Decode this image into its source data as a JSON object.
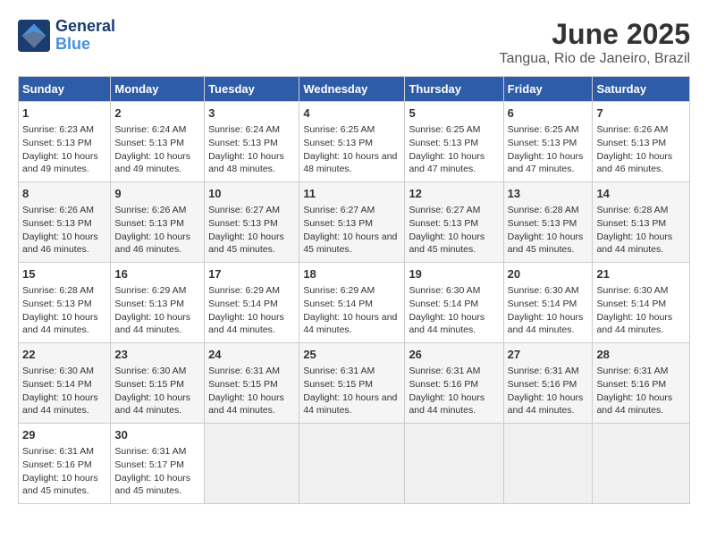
{
  "logo": {
    "line1": "General",
    "line2": "Blue"
  },
  "title": "June 2025",
  "location": "Tangua, Rio de Janeiro, Brazil",
  "days_of_week": [
    "Sunday",
    "Monday",
    "Tuesday",
    "Wednesday",
    "Thursday",
    "Friday",
    "Saturday"
  ],
  "weeks": [
    [
      {
        "day": "1",
        "sunrise": "Sunrise: 6:23 AM",
        "sunset": "Sunset: 5:13 PM",
        "daylight": "Daylight: 10 hours and 49 minutes."
      },
      {
        "day": "2",
        "sunrise": "Sunrise: 6:24 AM",
        "sunset": "Sunset: 5:13 PM",
        "daylight": "Daylight: 10 hours and 49 minutes."
      },
      {
        "day": "3",
        "sunrise": "Sunrise: 6:24 AM",
        "sunset": "Sunset: 5:13 PM",
        "daylight": "Daylight: 10 hours and 48 minutes."
      },
      {
        "day": "4",
        "sunrise": "Sunrise: 6:25 AM",
        "sunset": "Sunset: 5:13 PM",
        "daylight": "Daylight: 10 hours and 48 minutes."
      },
      {
        "day": "5",
        "sunrise": "Sunrise: 6:25 AM",
        "sunset": "Sunset: 5:13 PM",
        "daylight": "Daylight: 10 hours and 47 minutes."
      },
      {
        "day": "6",
        "sunrise": "Sunrise: 6:25 AM",
        "sunset": "Sunset: 5:13 PM",
        "daylight": "Daylight: 10 hours and 47 minutes."
      },
      {
        "day": "7",
        "sunrise": "Sunrise: 6:26 AM",
        "sunset": "Sunset: 5:13 PM",
        "daylight": "Daylight: 10 hours and 46 minutes."
      }
    ],
    [
      {
        "day": "8",
        "sunrise": "Sunrise: 6:26 AM",
        "sunset": "Sunset: 5:13 PM",
        "daylight": "Daylight: 10 hours and 46 minutes."
      },
      {
        "day": "9",
        "sunrise": "Sunrise: 6:26 AM",
        "sunset": "Sunset: 5:13 PM",
        "daylight": "Daylight: 10 hours and 46 minutes."
      },
      {
        "day": "10",
        "sunrise": "Sunrise: 6:27 AM",
        "sunset": "Sunset: 5:13 PM",
        "daylight": "Daylight: 10 hours and 45 minutes."
      },
      {
        "day": "11",
        "sunrise": "Sunrise: 6:27 AM",
        "sunset": "Sunset: 5:13 PM",
        "daylight": "Daylight: 10 hours and 45 minutes."
      },
      {
        "day": "12",
        "sunrise": "Sunrise: 6:27 AM",
        "sunset": "Sunset: 5:13 PM",
        "daylight": "Daylight: 10 hours and 45 minutes."
      },
      {
        "day": "13",
        "sunrise": "Sunrise: 6:28 AM",
        "sunset": "Sunset: 5:13 PM",
        "daylight": "Daylight: 10 hours and 45 minutes."
      },
      {
        "day": "14",
        "sunrise": "Sunrise: 6:28 AM",
        "sunset": "Sunset: 5:13 PM",
        "daylight": "Daylight: 10 hours and 44 minutes."
      }
    ],
    [
      {
        "day": "15",
        "sunrise": "Sunrise: 6:28 AM",
        "sunset": "Sunset: 5:13 PM",
        "daylight": "Daylight: 10 hours and 44 minutes."
      },
      {
        "day": "16",
        "sunrise": "Sunrise: 6:29 AM",
        "sunset": "Sunset: 5:13 PM",
        "daylight": "Daylight: 10 hours and 44 minutes."
      },
      {
        "day": "17",
        "sunrise": "Sunrise: 6:29 AM",
        "sunset": "Sunset: 5:14 PM",
        "daylight": "Daylight: 10 hours and 44 minutes."
      },
      {
        "day": "18",
        "sunrise": "Sunrise: 6:29 AM",
        "sunset": "Sunset: 5:14 PM",
        "daylight": "Daylight: 10 hours and 44 minutes."
      },
      {
        "day": "19",
        "sunrise": "Sunrise: 6:30 AM",
        "sunset": "Sunset: 5:14 PM",
        "daylight": "Daylight: 10 hours and 44 minutes."
      },
      {
        "day": "20",
        "sunrise": "Sunrise: 6:30 AM",
        "sunset": "Sunset: 5:14 PM",
        "daylight": "Daylight: 10 hours and 44 minutes."
      },
      {
        "day": "21",
        "sunrise": "Sunrise: 6:30 AM",
        "sunset": "Sunset: 5:14 PM",
        "daylight": "Daylight: 10 hours and 44 minutes."
      }
    ],
    [
      {
        "day": "22",
        "sunrise": "Sunrise: 6:30 AM",
        "sunset": "Sunset: 5:14 PM",
        "daylight": "Daylight: 10 hours and 44 minutes."
      },
      {
        "day": "23",
        "sunrise": "Sunrise: 6:30 AM",
        "sunset": "Sunset: 5:15 PM",
        "daylight": "Daylight: 10 hours and 44 minutes."
      },
      {
        "day": "24",
        "sunrise": "Sunrise: 6:31 AM",
        "sunset": "Sunset: 5:15 PM",
        "daylight": "Daylight: 10 hours and 44 minutes."
      },
      {
        "day": "25",
        "sunrise": "Sunrise: 6:31 AM",
        "sunset": "Sunset: 5:15 PM",
        "daylight": "Daylight: 10 hours and 44 minutes."
      },
      {
        "day": "26",
        "sunrise": "Sunrise: 6:31 AM",
        "sunset": "Sunset: 5:16 PM",
        "daylight": "Daylight: 10 hours and 44 minutes."
      },
      {
        "day": "27",
        "sunrise": "Sunrise: 6:31 AM",
        "sunset": "Sunset: 5:16 PM",
        "daylight": "Daylight: 10 hours and 44 minutes."
      },
      {
        "day": "28",
        "sunrise": "Sunrise: 6:31 AM",
        "sunset": "Sunset: 5:16 PM",
        "daylight": "Daylight: 10 hours and 44 minutes."
      }
    ],
    [
      {
        "day": "29",
        "sunrise": "Sunrise: 6:31 AM",
        "sunset": "Sunset: 5:16 PM",
        "daylight": "Daylight: 10 hours and 45 minutes."
      },
      {
        "day": "30",
        "sunrise": "Sunrise: 6:31 AM",
        "sunset": "Sunset: 5:17 PM",
        "daylight": "Daylight: 10 hours and 45 minutes."
      },
      {
        "day": "",
        "sunrise": "",
        "sunset": "",
        "daylight": ""
      },
      {
        "day": "",
        "sunrise": "",
        "sunset": "",
        "daylight": ""
      },
      {
        "day": "",
        "sunrise": "",
        "sunset": "",
        "daylight": ""
      },
      {
        "day": "",
        "sunrise": "",
        "sunset": "",
        "daylight": ""
      },
      {
        "day": "",
        "sunrise": "",
        "sunset": "",
        "daylight": ""
      }
    ]
  ]
}
